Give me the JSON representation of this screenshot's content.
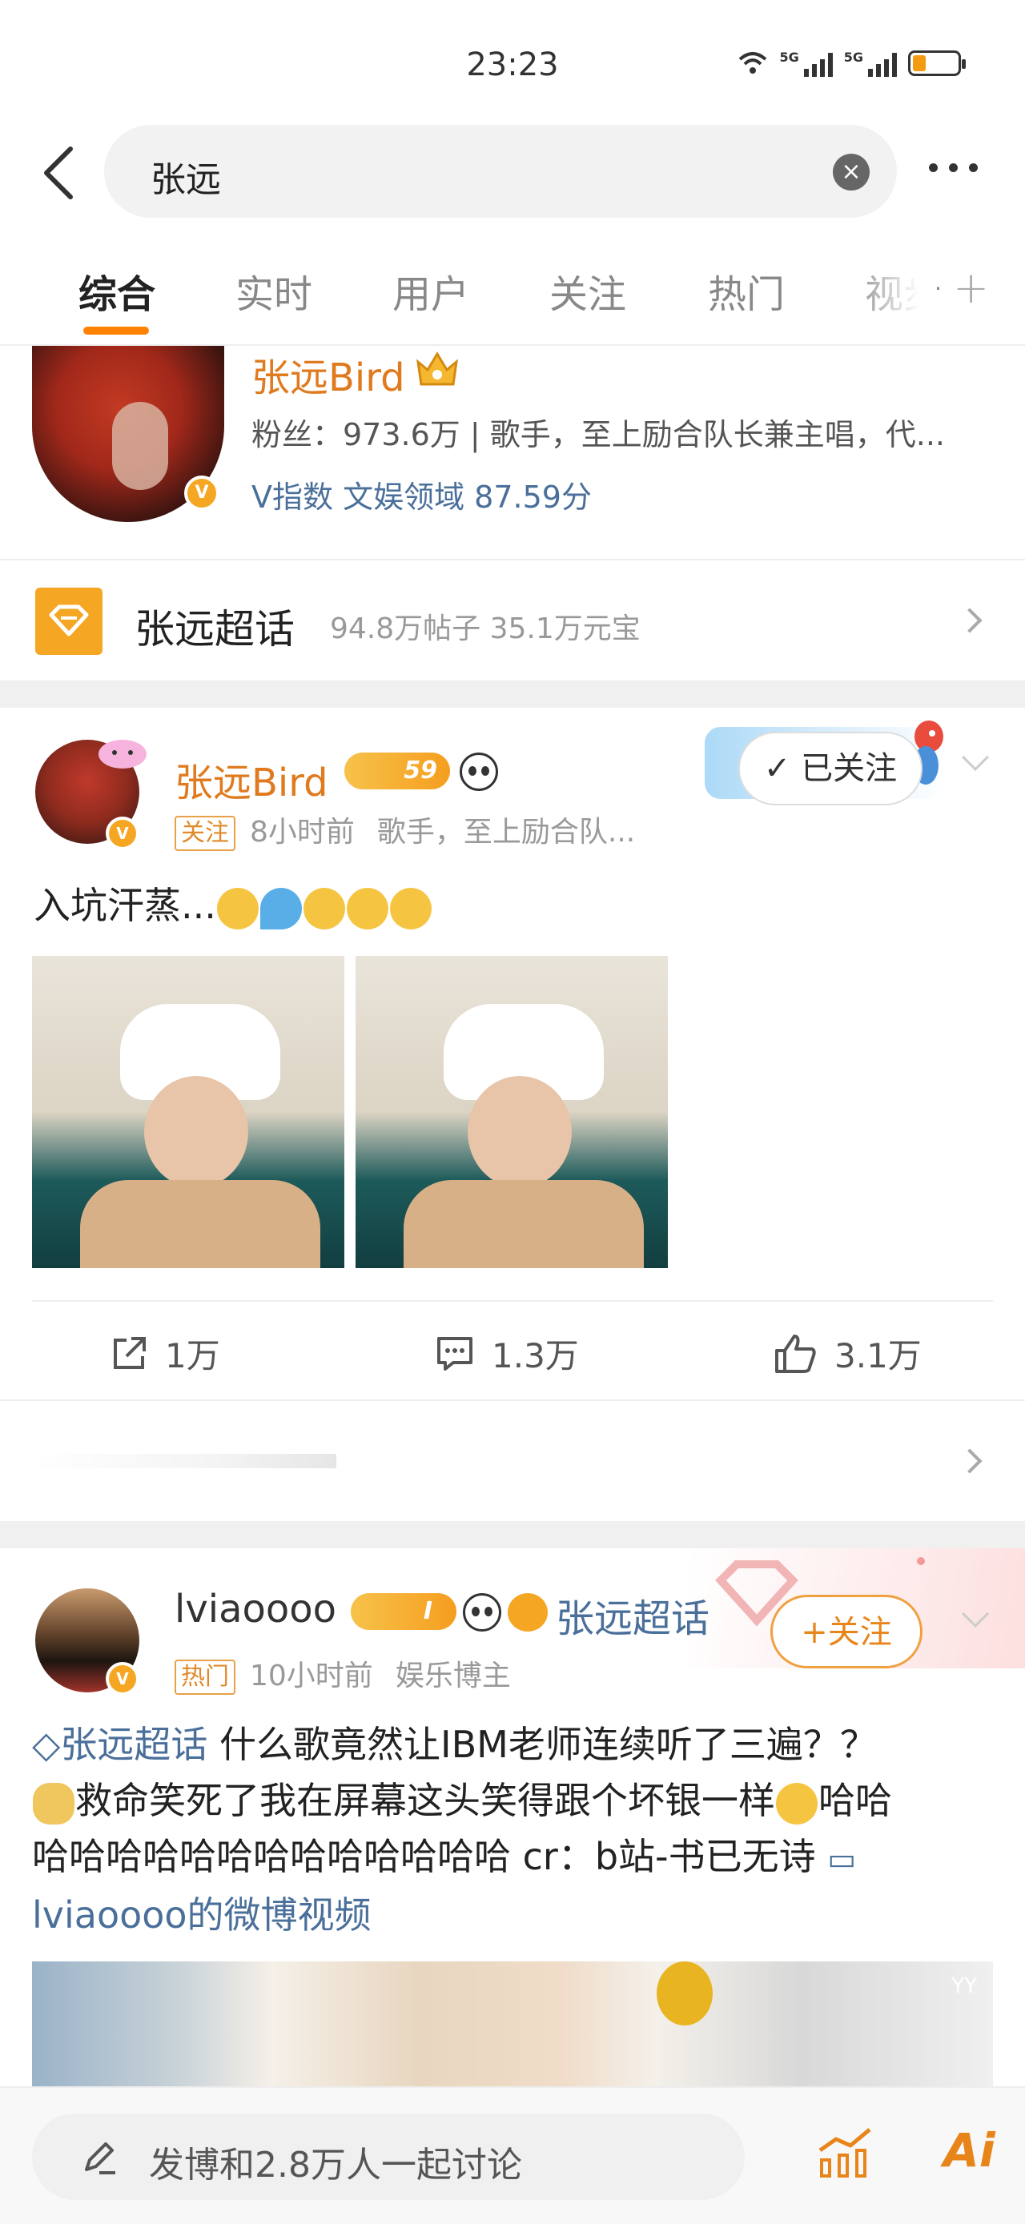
{
  "status_bar": {
    "time": "23:23",
    "signal1": "5G",
    "signal2": "5G"
  },
  "search": {
    "query": "张远"
  },
  "tabs": [
    "综合",
    "实时",
    "用户",
    "关注",
    "热门",
    "视步"
  ],
  "user_card": {
    "name": "张远Bird",
    "description": "粉丝：973.6万 | 歌手，至上励合队长兼主唱，代...",
    "index": "V指数 文娱领域 87.59分"
  },
  "super_topic": {
    "title": "张远超话",
    "stats": "94.8万帖子 35.1万元宝"
  },
  "post1": {
    "author": "张远Bird",
    "level_badge": "59",
    "tag": "关注",
    "time": "8小时前",
    "bio": "歌手，至上励合队...",
    "follow_label": "已关注",
    "text": "入坑汗蒸...",
    "repost_count": "1万",
    "comment_count": "1.3万",
    "like_count": "3.1万"
  },
  "post2": {
    "author": "lviaoooo",
    "level_badge": "I",
    "topic_link": "张远超话",
    "tag": "热门",
    "time": "10小时前",
    "bio": "娱乐博主",
    "follow_label": "+关注",
    "text_topic": "张远超话",
    "text_line1": "什么歌竟然让IBM老师连续听了三遍？？",
    "text_line2": "救命笑死了我在屏幕这头笑得跟个坏银一样",
    "text_line2_end": "哈哈",
    "text_line3": "哈哈哈哈哈哈哈哈哈哈哈哈哈 cr：b站-书已无诗",
    "video_link": "lviaoooo的微博视频",
    "video_watermark": "YY"
  },
  "bottom_bar": {
    "compose_placeholder": "发博和2.8万人一起讨论",
    "ai_label": "Ai"
  },
  "colors": {
    "accent": "#ff8200",
    "link": "#4a6f9a",
    "verified": "#f5a623"
  }
}
